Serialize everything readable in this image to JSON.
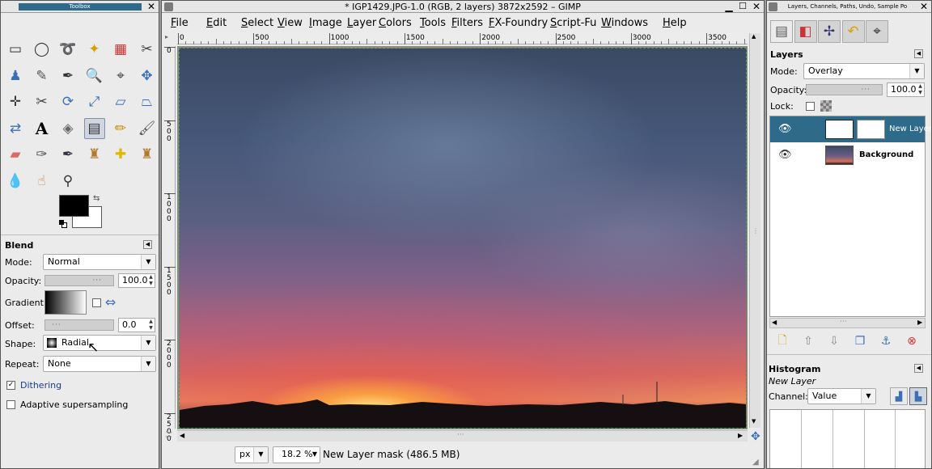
{
  "toolbox": {
    "title": "Toolbox",
    "tools": [
      {
        "name": "rect-select-icon",
        "glyph": "▭",
        "color": "#333"
      },
      {
        "name": "ellipse-select-icon",
        "glyph": "◯",
        "color": "#333"
      },
      {
        "name": "free-select-icon",
        "glyph": "➰",
        "color": "#555"
      },
      {
        "name": "fuzzy-select-icon",
        "glyph": "✦",
        "color": "#d8a000"
      },
      {
        "name": "select-by-color-icon",
        "glyph": "▦",
        "color": "#c33"
      },
      {
        "name": "scissors-icon",
        "glyph": "✂",
        "color": "#444"
      },
      {
        "name": "foreground-select-icon",
        "glyph": "♟",
        "color": "#3b6fb6"
      },
      {
        "name": "paths-icon",
        "glyph": "✎",
        "color": "#555"
      },
      {
        "name": "color-picker-icon",
        "glyph": "✒",
        "color": "#333"
      },
      {
        "name": "zoom-icon",
        "glyph": "🔍",
        "color": "#3b6fb6"
      },
      {
        "name": "measure-icon",
        "glyph": "⌖",
        "color": "#444"
      },
      {
        "name": "move-icon",
        "glyph": "✥",
        "color": "#3b6fb6"
      },
      {
        "name": "align-icon",
        "glyph": "✛",
        "color": "#333"
      },
      {
        "name": "crop-icon",
        "glyph": "✂",
        "color": "#444"
      },
      {
        "name": "rotate-icon",
        "glyph": "⟳",
        "color": "#3b6fb6"
      },
      {
        "name": "scale-icon",
        "glyph": "⤢",
        "color": "#3b6fb6"
      },
      {
        "name": "shear-icon",
        "glyph": "▱",
        "color": "#3b6fb6"
      },
      {
        "name": "perspective-icon",
        "glyph": "⏢",
        "color": "#3b6fb6"
      },
      {
        "name": "flip-icon",
        "glyph": "⇄",
        "color": "#3b6fb6"
      },
      {
        "name": "text-icon",
        "glyph": "A",
        "color": "#000"
      },
      {
        "name": "bucket-fill-icon",
        "glyph": "◈",
        "color": "#666"
      },
      {
        "name": "blend-icon",
        "glyph": "▤",
        "color": "#333"
      },
      {
        "name": "pencil-icon",
        "glyph": "✏",
        "color": "#c88a00"
      },
      {
        "name": "paintbrush-icon",
        "glyph": "🖌",
        "color": "#555"
      },
      {
        "name": "eraser-icon",
        "glyph": "▰",
        "color": "#e06666"
      },
      {
        "name": "airbrush-icon",
        "glyph": "✑",
        "color": "#555"
      },
      {
        "name": "ink-icon",
        "glyph": "✒",
        "color": "#334"
      },
      {
        "name": "clone-icon",
        "glyph": "♜",
        "color": "#b07a2a"
      },
      {
        "name": "heal-icon",
        "glyph": "✚",
        "color": "#e0b800"
      },
      {
        "name": "perspective-clone-icon",
        "glyph": "♜",
        "color": "#b07a2a"
      },
      {
        "name": "blur-sharpen-icon",
        "glyph": "💧",
        "color": "#3b8fd6"
      },
      {
        "name": "smudge-icon",
        "glyph": "☝",
        "color": "#d07a40"
      },
      {
        "name": "dodge-burn-icon",
        "glyph": "⚲",
        "color": "#333"
      }
    ],
    "fg_color": "#000000",
    "bg_color": "#ffffff",
    "options": {
      "title": "Blend",
      "mode_label": "Mode:",
      "mode_value": "Normal",
      "opacity_label": "Opacity:",
      "opacity_value": "100.0",
      "gradient_label": "Gradient:",
      "offset_label": "Offset:",
      "offset_value": "0.0",
      "shape_label": "Shape:",
      "shape_value": "Radial",
      "repeat_label": "Repeat:",
      "repeat_value": "None",
      "dithering_label": "Dithering",
      "adaptive_label": "Adaptive supersampling"
    }
  },
  "image_window": {
    "title": "* IGP1429.JPG-1.0 (RGB, 2 layers) 3872x2592 – GIMP",
    "menus": [
      "File",
      "Edit",
      "Select",
      "View",
      "Image",
      "Layer",
      "Colors",
      "Tools",
      "Filters",
      "FX-Foundry",
      "Script-Fu",
      "Windows",
      "Help"
    ],
    "ruler_h": [
      "0",
      "500",
      "1000",
      "1500",
      "2000",
      "2500",
      "3000",
      "3500"
    ],
    "ruler_v": [
      "0",
      "500",
      "1000",
      "1500",
      "2000",
      "2500"
    ],
    "unit": "px",
    "zoom": "18.2 %",
    "status": "New Layer mask (486.5 MB)"
  },
  "dock": {
    "title": "Layers, Channels, Paths, Undo, Sample Po",
    "tab_icons": [
      "layers-tab-icon",
      "channels-tab-icon",
      "paths-tab-icon",
      "undo-tab-icon",
      "sample-points-tab-icon"
    ],
    "layers": {
      "title": "Layers",
      "mode_label": "Mode:",
      "mode_value": "Overlay",
      "opacity_label": "Opacity:",
      "opacity_value": "100.0",
      "lock_label": "Lock:",
      "items": [
        {
          "name": "New Layer"
        },
        {
          "name": "Background"
        }
      ]
    },
    "layer_buttons": [
      "new-layer-icon",
      "raise-layer-icon",
      "lower-layer-icon",
      "duplicate-layer-icon",
      "anchor-layer-icon",
      "delete-layer-icon"
    ],
    "histogram": {
      "title": "Histogram",
      "subtitle": "New Layer",
      "channel_label": "Channel:",
      "channel_value": "Value"
    }
  },
  "colors": {
    "selected_row": "#2e6b8a",
    "canvas_border": "#4a9a4a"
  }
}
